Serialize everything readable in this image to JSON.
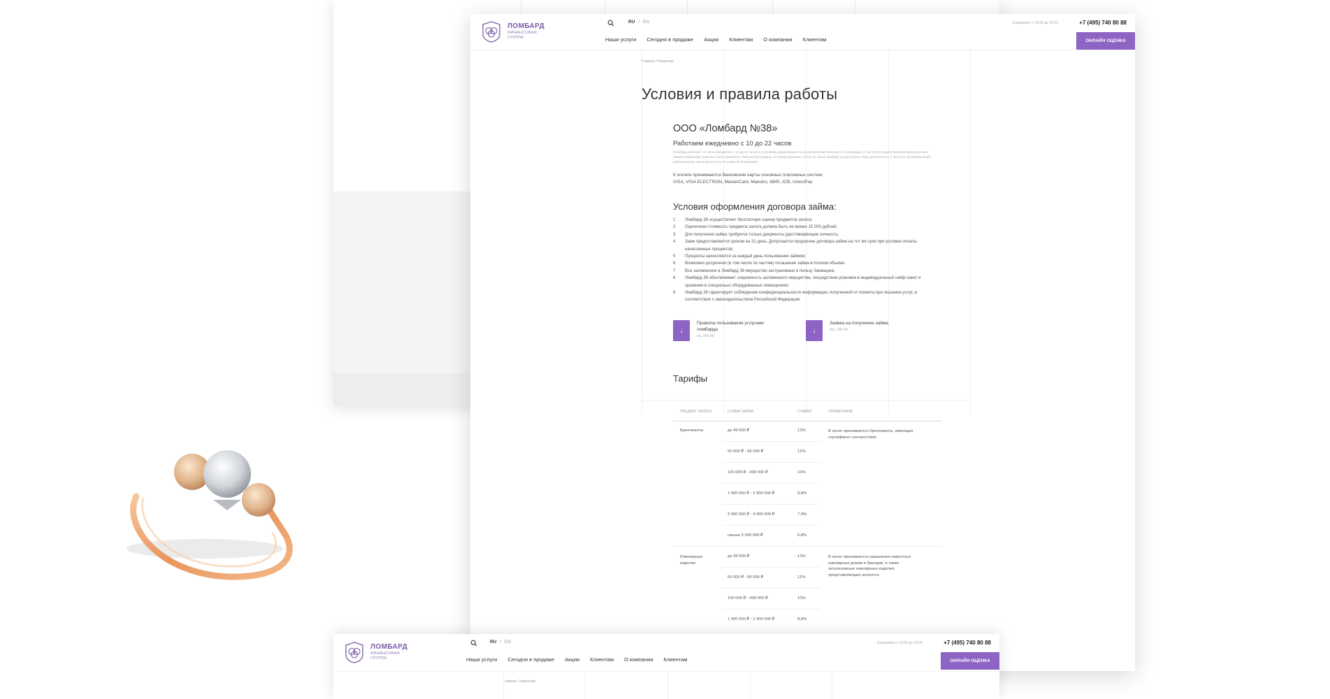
{
  "logo": {
    "title": "ЛОМБАРД",
    "sub_line1": "ФИНАНСОВАЯ",
    "sub_line2": "ГРУППА"
  },
  "header": {
    "lang_active": "RU",
    "lang_sep": "/",
    "lang_other": "EN",
    "hours": "Ежедневно с 10:00 до 22:00",
    "phone": "+7 (495) 740 80 88",
    "cta": "ОНЛАЙН ОЦЕНКА",
    "nav": [
      "Наши услуги",
      "Сегодня в продаже",
      "Акции",
      "Клиентам",
      "О компании",
      "Клиентам"
    ]
  },
  "breadcrumbs": "Главная / Клиентам",
  "page_title": "Условия и правила работы",
  "company": {
    "name": "ООО «Ломбард №38»",
    "hours_title": "Работаем ежедневно с 10 до 22 часов",
    "fine_print": "(Ломбард работает с 9 часов ежедневно с 10 до 22 часов по условиям кредитования по установленным Законом о С ломбардах, в том числе предоставления краткосрочных займов гражданам, приема в залог движимого Имущества граждан. В период времени с 20 до 22 часов Ломбард осуществляет свою деятельность в части не противоречащей действующему законодательству Российской Федерации)",
    "pay_line1": "К оплате принимаются банковские карты основных платежных систем:",
    "pay_line2": "VISA, VISA ELECTRON, MasterCard, Maestro, МИР, JCB, UnionPay"
  },
  "terms": {
    "title": "Условия оформления договора займа:",
    "items": [
      {
        "n": "1",
        "text": "Ломбард 38 осуществляет бесплатную оценку предметов залога;"
      },
      {
        "n": "2",
        "text": "Оценочная стоимость предмета залога должна быть не менее 15 000 рублей;"
      },
      {
        "n": "3",
        "text": "Для получения займа требуется только документы удостоверяющие личность;"
      },
      {
        "n": "4",
        "text": "Заем предоставляется сроком на 31 день. Допускается продление договора займа на тот же срок при условии оплаты начисленных процентов;"
      },
      {
        "n": "5",
        "text": "Проценты начисляются за каждый день пользования займом;"
      },
      {
        "n": "6",
        "text": "Возможно досрочное (в том числе по частям) погашение займа в полном объеме;"
      },
      {
        "n": "7",
        "text": "Все заложенное в Ломбард 38 имущество застраховано в пользу Заемщика;"
      },
      {
        "n": "8",
        "text": "Ломбард 38 обеспечивает сохранность заложенного имущества, посредством упаковки в индивидуальный сейф-пакет и хранения в специально оборудованных помещениях;"
      },
      {
        "n": "9",
        "text": "Ломбард 38 гарантирует соблюдение конфиденциальности информации, полученной от клиента при оказании услуг, в соответствии с законодательством Российской Федерации."
      }
    ]
  },
  "docs": [
    {
      "name": "Правила пользования услугами ломбарда",
      "meta": "xls, 356 Kb"
    },
    {
      "name": "Заявка на получение займа",
      "meta": "doc, 356 Kb"
    }
  ],
  "tariffs": {
    "title": "Тарифы",
    "headers": [
      "ПРЕДМЕТ ЗАЛОГА",
      "СУММА ЗАЙМА",
      "СТАВКА*",
      "ПРИМЕЧАНИЕ"
    ],
    "groups": [
      {
        "item": "Бриллианты",
        "note": "В залог принимаются бриллианты, имеющие сертификат соответствия",
        "rows": [
          {
            "sum": "до 49 000 ₽",
            "rate": "13%"
          },
          {
            "sum": "50 000 ₽ - 99 000 ₽",
            "rate": "12%"
          },
          {
            "sum": "100 000 ₽ - 499 000 ₽",
            "rate": "10%"
          },
          {
            "sum": "1 000 000 ₽ - 2 900 000 ₽",
            "rate": "8,8%"
          },
          {
            "sum": "3 000 000 ₽ - 4 900 000 ₽",
            "rate": "7,9%"
          },
          {
            "sum": "свыше 5 000 000 ₽",
            "rate": "6,8%"
          }
        ]
      },
      {
        "item": "Ювелирные изделия",
        "note": "В залог принимаются украшения известных ювелирных домов и брендов, а также эксклюзивные ювелирные изделия, представляющие ценность",
        "rows": [
          {
            "sum": "до 49 000 ₽",
            "rate": "13%"
          },
          {
            "sum": "50 000 ₽ - 99 000 ₽",
            "rate": "12%"
          },
          {
            "sum": "100 000 ₽ - 499 000 ₽",
            "rate": "10%"
          },
          {
            "sum": "1 000 000 ₽ - 2 900 000 ₽",
            "rate": "8,8%"
          }
        ]
      }
    ]
  },
  "icons": {
    "search": "search-icon",
    "download": "download-icon",
    "logo": "logo-emblem-icon"
  },
  "colors": {
    "accent": "#8d63c3",
    "logo": "#7b5ba6"
  }
}
